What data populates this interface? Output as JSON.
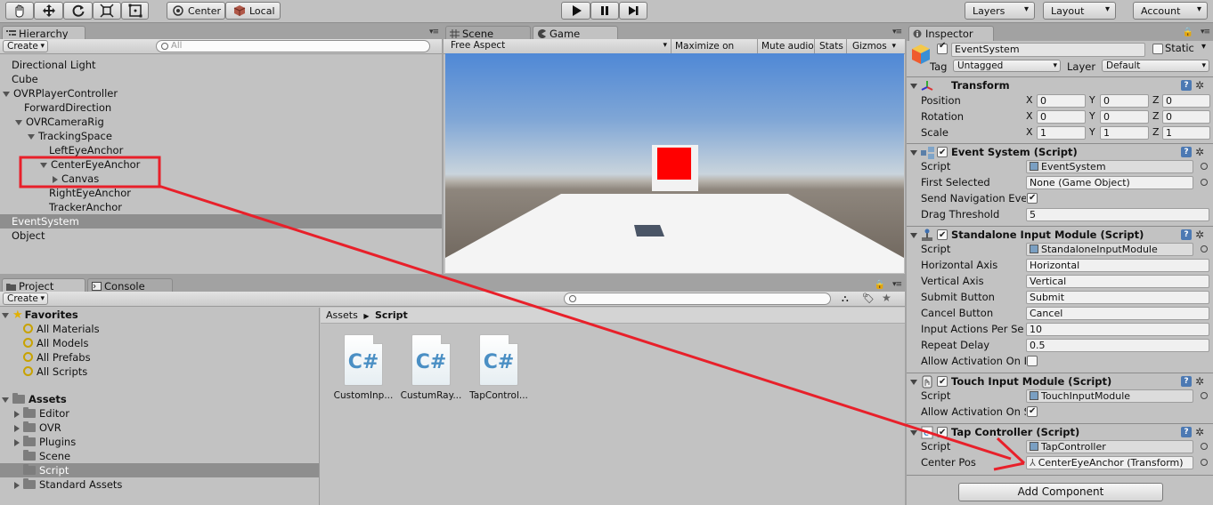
{
  "toolbar": {
    "pivot_label": "Center",
    "space_label": "Local",
    "layers_label": "Layers",
    "layout_label": "Layout",
    "account_label": "Account"
  },
  "hierarchy": {
    "tab": "Hierarchy",
    "create_label": "Create",
    "search_placeholder": "All",
    "items": [
      {
        "label": "Directional Light"
      },
      {
        "label": "Cube"
      },
      {
        "label": "OVRPlayerController"
      },
      {
        "label": "ForwardDirection"
      },
      {
        "label": "OVRCameraRig"
      },
      {
        "label": "TrackingSpace"
      },
      {
        "label": "LeftEyeAnchor"
      },
      {
        "label": "CenterEyeAnchor"
      },
      {
        "label": "Canvas"
      },
      {
        "label": "RightEyeAnchor"
      },
      {
        "label": "TrackerAnchor"
      },
      {
        "label": "EventSystem"
      },
      {
        "label": "Object"
      }
    ]
  },
  "view": {
    "tabs": [
      {
        "label": "Scene"
      },
      {
        "label": "Game"
      }
    ],
    "aspect_label": "Free Aspect",
    "maximize_label": "Maximize on Play",
    "mute_label": "Mute audio",
    "stats_label": "Stats",
    "gizmos_label": "Gizmos"
  },
  "project": {
    "tabs": [
      {
        "label": "Project"
      },
      {
        "label": "Console"
      }
    ],
    "create_label": "Create",
    "favorites_label": "Favorites",
    "favorites": [
      {
        "label": "All Materials"
      },
      {
        "label": "All Models"
      },
      {
        "label": "All Prefabs"
      },
      {
        "label": "All Scripts"
      }
    ],
    "assets_label": "Assets",
    "folders": [
      {
        "label": "Editor"
      },
      {
        "label": "OVR"
      },
      {
        "label": "Plugins"
      },
      {
        "label": "Scene"
      },
      {
        "label": "Script"
      },
      {
        "label": "Standard Assets"
      }
    ],
    "breadcrumb": {
      "root": "Assets",
      "sep": "▶",
      "current": "Script"
    },
    "files": [
      {
        "label": "CustomInp..."
      },
      {
        "label": "CustumRay..."
      },
      {
        "label": "TapControl..."
      }
    ],
    "file_glyph": "C#"
  },
  "inspector": {
    "tab": "Inspector",
    "object_name": "EventSystem",
    "static_label": "Static",
    "tag_label": "Tag",
    "tag_value": "Untagged",
    "layer_label": "Layer",
    "layer_value": "Default",
    "transform": {
      "title": "Transform",
      "position_label": "Position",
      "rotation_label": "Rotation",
      "scale_label": "Scale",
      "axis_x": "X",
      "axis_y": "Y",
      "axis_z": "Z",
      "position": [
        "0",
        "0",
        "0"
      ],
      "rotation": [
        "0",
        "0",
        "0"
      ],
      "scale": [
        "1",
        "1",
        "1"
      ]
    },
    "event_system": {
      "title": "Event System (Script)",
      "script_label": "Script",
      "script_value": "EventSystem",
      "first_selected_label": "First Selected",
      "first_selected_value": "None (Game Object)",
      "send_nav_label": "Send Navigation Eve",
      "drag_threshold_label": "Drag Threshold",
      "drag_threshold_value": "5"
    },
    "standalone": {
      "title": "Standalone Input Module (Script)",
      "rows": [
        {
          "label": "Script",
          "value": "StandaloneInputModule"
        },
        {
          "label": "Horizontal Axis",
          "value": "Horizontal"
        },
        {
          "label": "Vertical Axis",
          "value": "Vertical"
        },
        {
          "label": "Submit Button",
          "value": "Submit"
        },
        {
          "label": "Cancel Button",
          "value": "Cancel"
        },
        {
          "label": "Input Actions Per Se",
          "value": "10"
        },
        {
          "label": "Repeat Delay",
          "value": "0.5"
        }
      ],
      "allow_activation_label": "Allow Activation On I"
    },
    "touch": {
      "title": "Touch Input Module (Script)",
      "script_label": "Script",
      "script_value": "TouchInputModule",
      "allow_activation_label": "Allow Activation On S"
    },
    "tap": {
      "title": "Tap Controller (Script)",
      "script_label": "Script",
      "script_value": "TapController",
      "center_pos_label": "Center Pos",
      "center_pos_value": "CenterEyeAnchor (Transform)"
    },
    "add_component_label": "Add Component"
  },
  "annotation": {
    "color": "#e8202a"
  }
}
